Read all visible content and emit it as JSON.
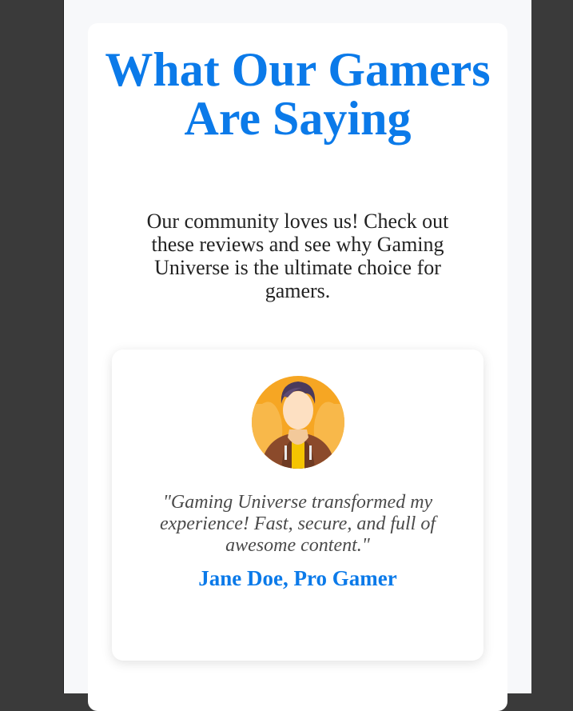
{
  "section": {
    "title": "What Our Gamers Are Saying",
    "subtitle": "Our community loves us! Check out these reviews and see why Gaming Universe is the ultimate choice for gamers."
  },
  "testimonial": {
    "avatar_icon": "gamer-avatar-icon",
    "quote": "\"Gaming Universe transformed my experience! Fast, secure, and full of awesome content.\"",
    "author": "Jane Doe, Pro Gamer"
  },
  "colors": {
    "accent": "#0b7ae9",
    "background": "#f7f8fa",
    "outer": "#3a3a3a",
    "card": "#ffffff"
  }
}
